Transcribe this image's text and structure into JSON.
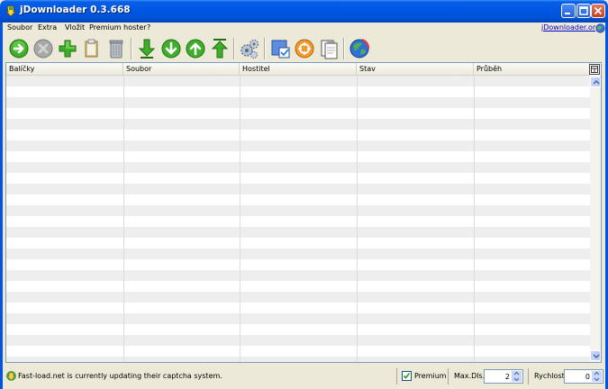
{
  "window": {
    "title": "jDownloader 0.3.668"
  },
  "menu": {
    "items": [
      {
        "label": "Soubor"
      },
      {
        "label": "Extra"
      },
      {
        "label": "Vložit"
      },
      {
        "label": "Premium hoster"
      },
      {
        "label": "?"
      }
    ],
    "site_link": "jDownloader.org"
  },
  "toolbar": {
    "buttons": [
      {
        "icon": "start-icon"
      },
      {
        "icon": "stop-icon"
      },
      {
        "icon": "add-icon"
      },
      {
        "icon": "clipboard-folder-icon"
      },
      {
        "icon": "trash-icon"
      },
      {
        "icon": "move-bottom-icon"
      },
      {
        "icon": "move-down-icon"
      },
      {
        "icon": "move-up-icon"
      },
      {
        "icon": "move-top-icon"
      },
      {
        "icon": "settings-icon"
      },
      {
        "icon": "reconnect-icon"
      },
      {
        "icon": "update-icon"
      },
      {
        "icon": "log-icon"
      },
      {
        "icon": "globe-icon"
      }
    ]
  },
  "table": {
    "columns": [
      {
        "label": "Balíčky"
      },
      {
        "label": "Soubor"
      },
      {
        "label": "Hostitel"
      },
      {
        "label": "Stav"
      },
      {
        "label": "Průběh"
      }
    ]
  },
  "statusbar": {
    "message": "Fast-load.net is currently updating their captcha system.",
    "premium_label": "Premium",
    "premium_checked": true,
    "max_dls_label": "Max.Dls.",
    "max_dls_value": "2",
    "speed_label": "Rychlost",
    "speed_value": "0"
  },
  "colors": {
    "titlebar": "#0058e6",
    "row_alt": "#eeeeee",
    "link": "#0000cc"
  }
}
